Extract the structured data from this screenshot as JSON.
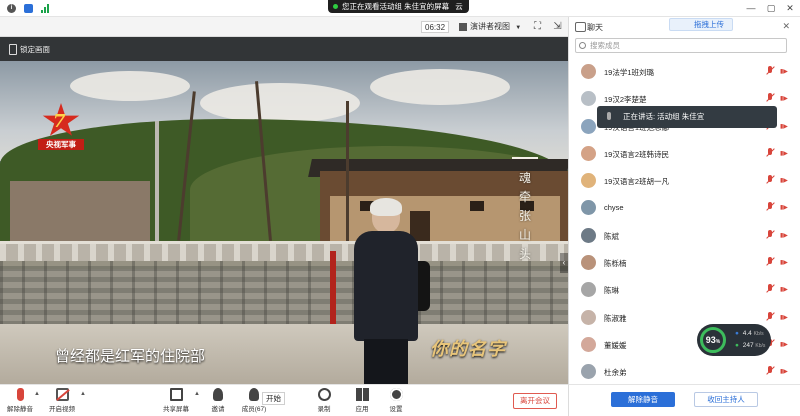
{
  "topbar": {
    "sharing_notice": "您正在观看活动组  朱佳宜的屏幕",
    "extra_label": "云",
    "window_controls": [
      "—",
      "▢",
      "✕"
    ]
  },
  "video_toolbar": {
    "timer": "06:32",
    "view_label": "演讲者视图",
    "lock_label": "锁定画面"
  },
  "video": {
    "channel_logo_text": "央视军事",
    "channel_number": "7",
    "vertical_title": [
      "魂",
      "牵",
      "张",
      "山",
      "头"
    ],
    "subtitle": "曾经都是红军的住院部",
    "brush_title": "你的名字"
  },
  "panel": {
    "tab": "聊天",
    "upload_label": "拖拽上传",
    "close": "✕",
    "search_placeholder": "搜索成员",
    "members": [
      {
        "name": "19法学1班刘璐",
        "color": "#c9a08a"
      },
      {
        "name": "19汉2李楚楚",
        "color": "#b8bfc6"
      },
      {
        "name": "19汉语言1班范思娜",
        "color": "#8ba4bd"
      },
      {
        "name": "19汉语言2班韩诗民",
        "color": "#d4a286"
      },
      {
        "name": "19汉语言2班胡一凡",
        "color": "#e0b37a"
      },
      {
        "name": "chyse",
        "color": "#7f96a8"
      },
      {
        "name": "陈斌",
        "color": "#6d7a86"
      },
      {
        "name": "陈栎楠",
        "color": "#b9927a"
      },
      {
        "name": "陈琳",
        "color": "#a6a6a6"
      },
      {
        "name": "陈淑雅",
        "color": "#c6b3a8"
      },
      {
        "name": "董媛媛",
        "color": "#d3a89a"
      },
      {
        "name": "杜余弟",
        "color": "#9aa3ad"
      }
    ],
    "tooltip": "正在讲话: 活动组  朱佳宜",
    "mute_all": "解除静音",
    "reclaim_host": "收回主持人"
  },
  "network": {
    "quality": "93",
    "quality_unit": "%",
    "upload": "4.4",
    "upload_unit": "Kb/s",
    "download": "247",
    "download_unit": "Kb/s"
  },
  "toolbar": {
    "unmute": "解除静音",
    "camera": "开启视频",
    "share": "共享屏幕",
    "invite": "邀请",
    "members": "成员(67)",
    "start_tip": "开始",
    "record": "录制",
    "apps": "应用",
    "settings": "设置",
    "leave": "离开会议"
  },
  "colors": {
    "accent": "#2b6fd8",
    "danger": "#d8453b",
    "network_ok": "#3dbc5c"
  }
}
